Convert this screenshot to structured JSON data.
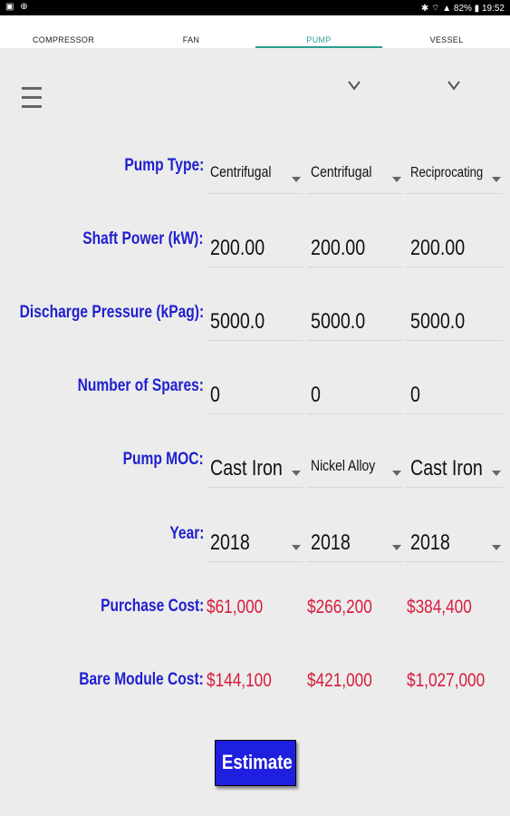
{
  "status": {
    "left_icons": "▣ ⊕",
    "right_text": "✱ ⌔ ▲ 82% ▮ 19:52"
  },
  "tabs": [
    {
      "label": "COMPRESSOR",
      "active": false
    },
    {
      "label": "FAN",
      "active": false
    },
    {
      "label": "PUMP",
      "active": true
    },
    {
      "label": "VESSEL",
      "active": false
    }
  ],
  "accent_color": "#2a9d8f",
  "rows": {
    "pump_type": {
      "label": "Pump Type:",
      "values": [
        "Centrifugal",
        "Centrifugal",
        "Reciprocating"
      ]
    },
    "shaft_power": {
      "label": "Shaft Power (kW):",
      "values": [
        "200.00",
        "200.00",
        "200.00"
      ]
    },
    "discharge_pressure": {
      "label": "Discharge Pressure (kPag):",
      "values": [
        "5000.0",
        "5000.0",
        "5000.0"
      ]
    },
    "spares": {
      "label": "Number of Spares:",
      "values": [
        "0",
        "0",
        "0"
      ]
    },
    "moc": {
      "label": "Pump MOC:",
      "values": [
        "Cast Iron",
        "Nickel Alloy",
        "Cast Iron"
      ]
    },
    "year": {
      "label": "Year:",
      "values": [
        "2018",
        "2018",
        "2018"
      ]
    },
    "purchase_cost": {
      "label": "Purchase Cost:",
      "values": [
        "$61,000",
        "$266,200",
        "$384,400"
      ]
    },
    "bare_module_cost": {
      "label": "Bare Module Cost:",
      "values": [
        "$144,100",
        "$421,000",
        "$1,027,000"
      ]
    }
  },
  "estimate_label": "Estimate",
  "label_color": "#1f1fcf",
  "cost_color": "#d81b3c"
}
